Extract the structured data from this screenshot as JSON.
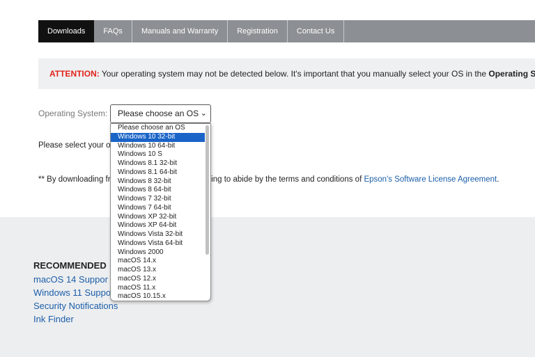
{
  "tabs": [
    "Downloads",
    "FAQs",
    "Manuals and Warranty",
    "Registration",
    "Contact Us"
  ],
  "attention": {
    "label": "ATTENTION:",
    "text": " Your operating system may not be detected below. It's important that you manually select your OS in the ",
    "bold": "Operating Sys"
  },
  "os": {
    "label": "Operating System:",
    "selected": "Please choose an OS",
    "chevron": "⌄"
  },
  "dropdown_options": [
    "Please choose an OS",
    "Windows 10 32-bit",
    "Windows 10 64-bit",
    "Windows 10 S",
    "Windows 8.1 32-bit",
    "Windows 8.1 64-bit",
    "Windows 8 32-bit",
    "Windows 8 64-bit",
    "Windows 7 32-bit",
    "Windows 7 64-bit",
    "Windows XP 32-bit",
    "Windows XP 64-bit",
    "Windows Vista 32-bit",
    "Windows Vista 64-bit",
    "Windows 2000",
    "macOS 14.x",
    "macOS 13.x",
    "macOS 12.x",
    "macOS 11.x",
    "macOS 10.15.x"
  ],
  "highlighted_option": "Windows 10 32-bit",
  "select_os_text": "Please select your o",
  "download_text": {
    "before": "** By downloading fr",
    "middle": "reeing to abide by the terms and conditions of ",
    "link": "Epson's Software License Agreement",
    "after": "."
  },
  "recommended": {
    "heading": "RECOMMENDED",
    "links": [
      "macOS 14 Suppor",
      "Windows 11 Suppo",
      "Security Notifications",
      "Ink Finder"
    ]
  }
}
